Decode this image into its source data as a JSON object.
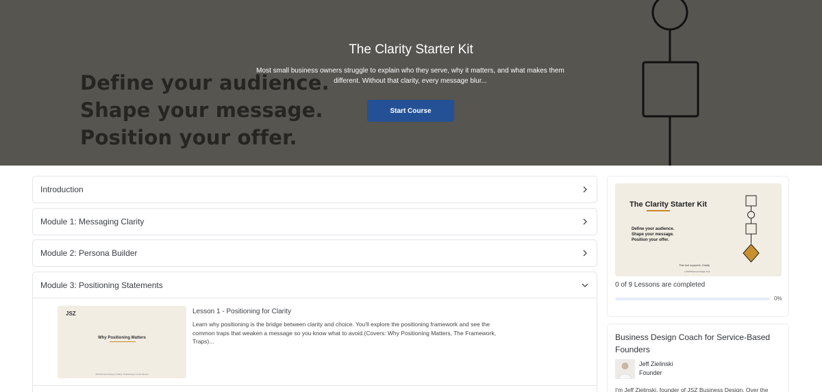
{
  "hero": {
    "title": "The Clarity Starter Kit",
    "description": "Most small business owners struggle to explain who they serve, why it matters, and what makes them different. Without that clarity, every message blur...",
    "button_label": "Start Course",
    "background_lines": [
      "Define your audience.",
      "Shape your message.",
      "Position your offer."
    ],
    "background_color": "#575550",
    "button_color": "#245196"
  },
  "modules": [
    {
      "title": "Introduction",
      "state": "collapsed"
    },
    {
      "title": "Module 1: Messaging Clarity",
      "state": "collapsed"
    },
    {
      "title": "Module 2: Persona Builder",
      "state": "collapsed"
    },
    {
      "title": "Module 3: Positioning Statements",
      "state": "expanded"
    }
  ],
  "lessons": [
    {
      "title": "Lesson 1 - Positioning for Clarity",
      "description": "Learn why positioning is the bridge between clarity and choice. You'll explore the positioning framework and see the common traps that weaken a message so you know what to avoid.(Covers: Why Positioning Matters, The Framework, Traps)...",
      "thumbnail": {
        "brand": "JSZ",
        "title": "Why Positioning Matters",
        "footer": "JSZ Business Design | Clarity: Positioning in a Lite Version"
      }
    }
  ],
  "sidebar": {
    "course_image": {
      "title": "The Clarity Starter Kit",
      "lines": [
        "Define your audience.",
        "Shape your message.",
        "Position your offer."
      ],
      "supports": "This tool supports: Clarity",
      "brand": "a JSZ Business Design Tool"
    },
    "progress": {
      "text": "0 of 9 Lessons are completed",
      "percent_label": "0%",
      "fraction": 0
    },
    "instructor": {
      "heading": "Business Design Coach for Service-Based Founders",
      "name": "Jeff Zielinski",
      "role": "Founder",
      "bio": "I'm Jeff Zielinski, founder of JSZ Business Design. Over the"
    }
  },
  "colors": {
    "accent": "#245196",
    "border": "#e2e4e8",
    "thumbnail_bg": "#f1ede3",
    "underline": "#c8872e"
  },
  "icons": {
    "collapsed": "chevron-right-icon",
    "expanded": "chevron-down-icon"
  }
}
